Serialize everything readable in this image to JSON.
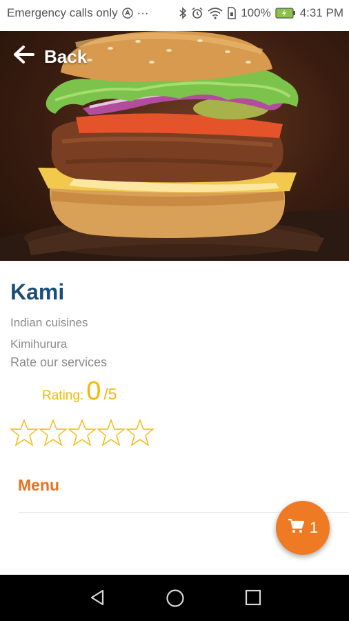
{
  "status_bar": {
    "carrier": "Emergency calls only",
    "battery": "100%",
    "time": "4:31 PM"
  },
  "header": {
    "back_label": "Back",
    "back_icon": "arrow-left-icon"
  },
  "restaurant": {
    "name": "Kami",
    "cuisine": "Indian cuisines",
    "location": "Kimihurura",
    "rate_prompt": "Rate our services",
    "rating_label": "Rating:",
    "rating_value": "0",
    "rating_max": "/5",
    "stars_filled": 0,
    "stars_total": 5
  },
  "tabs": {
    "menu_label": "Menu"
  },
  "cart": {
    "count": "1",
    "icon": "cart-icon"
  },
  "colors": {
    "title": "#1a4f7a",
    "accent": "#e8711f",
    "rating": "#f2b705",
    "muted": "#8a8a8a"
  }
}
